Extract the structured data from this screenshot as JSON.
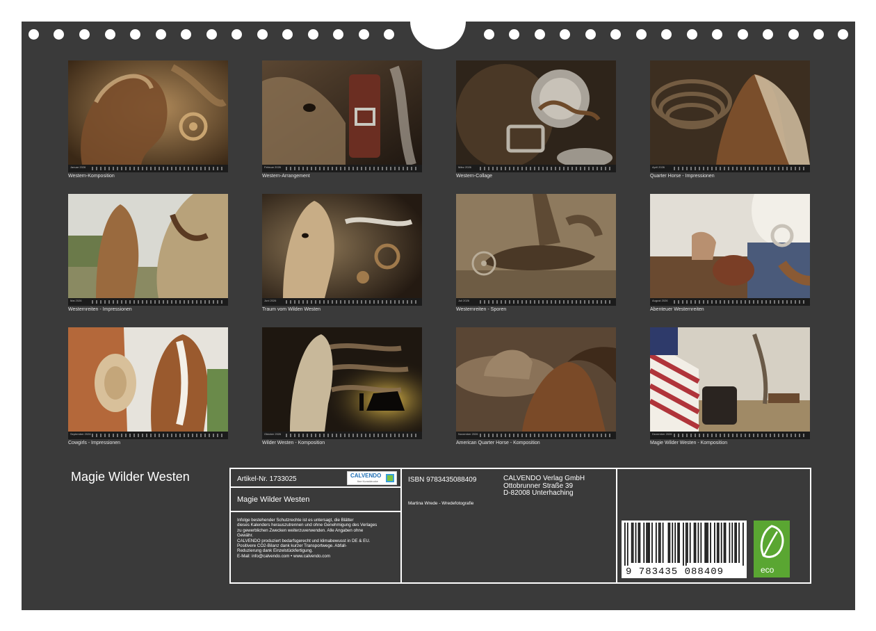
{
  "calendar": {
    "title": "Magie Wilder Westen",
    "months": [
      {
        "month": "Januar 2026",
        "caption": "Western-Komposition"
      },
      {
        "month": "Februar 2026",
        "caption": "Western-Arrangement"
      },
      {
        "month": "März 2026",
        "caption": "Western-Collage"
      },
      {
        "month": "April 2026",
        "caption": "Quarter Horse - Impressionen"
      },
      {
        "month": "Mai 2026",
        "caption": "Westernreiten - Impressionen"
      },
      {
        "month": "Juni 2026",
        "caption": "Traum vom Wilden Westen"
      },
      {
        "month": "Juli 2026",
        "caption": "Westernreiten - Sporen"
      },
      {
        "month": "August 2026",
        "caption": "Abenteuer Westernreiten"
      },
      {
        "month": "September 2026",
        "caption": "Cowgirls - Impressionen"
      },
      {
        "month": "Oktober 2026",
        "caption": "Wilder Westen - Komposition"
      },
      {
        "month": "November 2026",
        "caption": "American Quarter Horse - Komposition"
      },
      {
        "month": "Dezember 2026",
        "caption": "Magie Wilder Westen - Komposition"
      }
    ]
  },
  "info_box": {
    "article": "Artikel-Nr. 1733025",
    "product_title": "Magie Wilder Westen",
    "logo_name": "CALVENDO",
    "logo_tagline": "fine Kunstdrucke",
    "isbn": "ISBN 9783435088409",
    "photographer": "Martina Wrede - Wredefotografie",
    "publisher": {
      "name": "CALVENDO Verlag GmbH",
      "street": "Ottobrunner Straße 39",
      "city": "D-82008 Unterhaching"
    },
    "legal_lines": [
      "Infolge bestehender Schutzrechte ist es untersagt, die Blätter",
      "dieses Kalenders herauszutrennen und ohne Genehmigung des Verlages",
      "zu gewerblichen Zwecken weiterzuverwenden. Alle Angaben ohne",
      "Gewähr.",
      "CALVENDO produziert bedarfsgerecht und klimabewusst in DE & EU.",
      "Positivere CO2-Bilanz dank kurzer Transportwege. Abfall-",
      "Reduzierung dank Einzelstückfertigung.",
      "E-Mail: info@calvendo.com • www.calvendo.com"
    ],
    "barcode_digits": "9  783435  088409",
    "eco_label": "eco"
  },
  "colors": {
    "page_background": "#3a3a3a",
    "text": "#ffffff",
    "eco_green": "#5aa632",
    "logo_blue": "#1f6fb5"
  }
}
